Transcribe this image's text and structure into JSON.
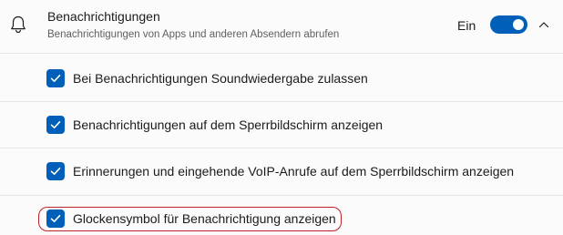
{
  "header": {
    "icon": "bell-icon",
    "title": "Benachrichtigungen",
    "subtitle": "Benachrichtigungen von Apps und anderen Absendern abrufen",
    "toggle_label": "Ein",
    "toggle_on": true,
    "expand_icon": "chevron-up-icon"
  },
  "options": [
    {
      "label": "Bei Benachrichtigungen Soundwiedergabe zulassen",
      "checked": true
    },
    {
      "label": "Benachrichtigungen auf dem Sperrbildschirm anzeigen",
      "checked": true
    },
    {
      "label": "Erinnerungen und eingehende VoIP-Anrufe auf dem Sperrbildschirm anzeigen",
      "checked": true
    },
    {
      "label": "Glockensymbol für Benachrichtigung anzeigen",
      "checked": true
    }
  ],
  "colors": {
    "accent": "#005fb8",
    "highlight": "#c0212b"
  }
}
